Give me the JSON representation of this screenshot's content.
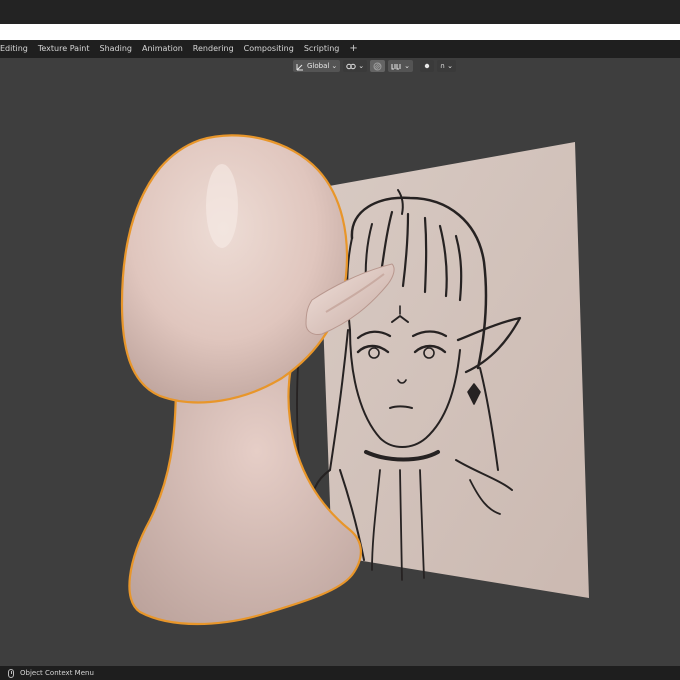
{
  "workspace_tabs": [
    "Editing",
    "Texture Paint",
    "Shading",
    "Animation",
    "Rendering",
    "Compositing",
    "Scripting"
  ],
  "add_tab_label": "+",
  "header": {
    "orientation": "Global",
    "dropdown_arrow": "⌄",
    "proportional_icon": "∩"
  },
  "statusbar": {
    "hint": "Object Context Menu"
  },
  "colors": {
    "viewport_bg": "#3e3e3e",
    "selection_outline": "#e8962a",
    "head_skin": "#e3c9c1",
    "reference_plane": "#d6c7c0"
  },
  "icons": {
    "transform_pivot": "pivot-icon",
    "snap": "snap-icon",
    "mouse": "mouse-icon"
  }
}
